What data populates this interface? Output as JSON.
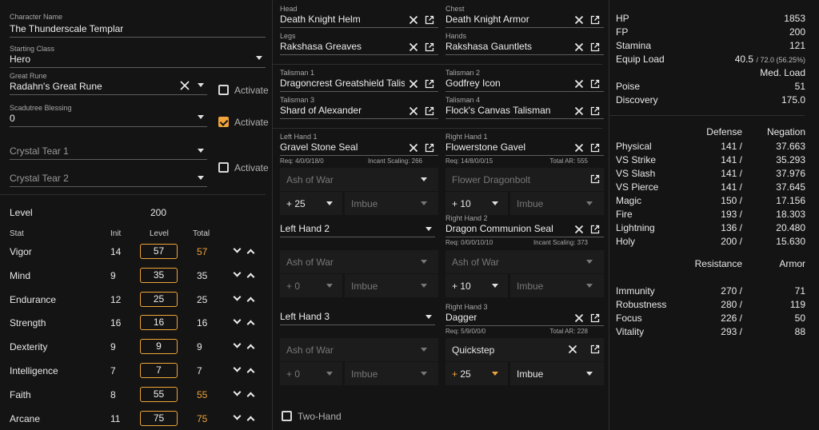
{
  "left": {
    "character_name": {
      "label": "Character Name",
      "value": "The Thunderscale Templar"
    },
    "starting_class": {
      "label": "Starting Class",
      "value": "Hero"
    },
    "great_rune": {
      "label": "Great Rune",
      "value": "Radahn's Great Rune",
      "activate_label": "Activate"
    },
    "scadutree": {
      "label": "Scadutree Blessing",
      "value": "0",
      "activate_label": "Activate"
    },
    "crystal_tear_1": "Crystal Tear 1",
    "crystal_tear_2": "Crystal Tear 2",
    "tears_activate_label": "Activate",
    "level_label": "Level",
    "level_value": "200",
    "stat_headers": {
      "stat": "Stat",
      "init": "Init",
      "level": "Level",
      "total": "Total"
    },
    "stats": [
      {
        "name": "Vigor",
        "init": "14",
        "level": "57",
        "total": "57",
        "highlight": true
      },
      {
        "name": "Mind",
        "init": "9",
        "level": "35",
        "total": "35",
        "highlight": false
      },
      {
        "name": "Endurance",
        "init": "12",
        "level": "25",
        "total": "25",
        "highlight": false
      },
      {
        "name": "Strength",
        "init": "16",
        "level": "16",
        "total": "16",
        "highlight": false
      },
      {
        "name": "Dexterity",
        "init": "9",
        "level": "9",
        "total": "9",
        "highlight": false
      },
      {
        "name": "Intelligence",
        "init": "7",
        "level": "7",
        "total": "7",
        "highlight": false
      },
      {
        "name": "Faith",
        "init": "8",
        "level": "55",
        "total": "55",
        "highlight": true
      },
      {
        "name": "Arcane",
        "init": "11",
        "level": "75",
        "total": "75",
        "highlight": true
      }
    ]
  },
  "armor": {
    "head": {
      "label": "Head",
      "value": "Death Knight Helm"
    },
    "chest": {
      "label": "Chest",
      "value": "Death Knight Armor"
    },
    "legs": {
      "label": "Legs",
      "value": "Rakshasa Greaves"
    },
    "hands": {
      "label": "Hands",
      "value": "Rakshasa Gauntlets"
    }
  },
  "talismans": {
    "t1": {
      "label": "Talisman 1",
      "value": "Dragoncrest Greatshield Talisman"
    },
    "t2": {
      "label": "Talisman 2",
      "value": "Godfrey Icon"
    },
    "t3": {
      "label": "Talisman 3",
      "value": "Shard of Alexander"
    },
    "t4": {
      "label": "Talisman 4",
      "value": "Flock's Canvas Talisman"
    }
  },
  "weapons": {
    "lh1": {
      "label": "Left Hand 1",
      "value": "Gravel Stone Seal",
      "req": "Req: 4/0/0/18/0",
      "extra": "Incant Scaling: 266",
      "aow": "Ash of War",
      "upgrade": "+ 25",
      "affinity": "Imbue"
    },
    "rh1": {
      "label": "Right Hand 1",
      "value": "Flowerstone Gavel",
      "req": "Req: 14/8/0/0/15",
      "extra": "Total AR: 555",
      "aow": "Flower Dragonbolt",
      "upgrade": "+ 10",
      "affinity": "Imbue"
    },
    "lh2": {
      "value": "Left Hand 2",
      "aow": "Ash of War",
      "upgrade": "+ 0",
      "affinity": "Imbue"
    },
    "rh2": {
      "label": "Right Hand 2",
      "value": "Dragon Communion Seal",
      "req": "Req: 0/0/0/10/10",
      "extra": "Incant Scaling: 373",
      "aow": "Ash of War",
      "upgrade": "+ 10",
      "affinity": "Imbue"
    },
    "lh3": {
      "value": "Left Hand 3",
      "aow": "Ash of War",
      "upgrade": "+ 0",
      "affinity": "Imbue"
    },
    "rh3": {
      "label": "Right Hand 3",
      "value": "Dagger",
      "req": "Req: 5/9/0/0/0",
      "extra": "Total AR: 228",
      "aow": "Quickstep",
      "upgrade_plus": "+",
      "upgrade_num": "25",
      "affinity": "Imbue"
    },
    "two_hand_label": "Two-Hand"
  },
  "stats_panel": {
    "top": [
      {
        "label": "HP",
        "value": "1853"
      },
      {
        "label": "FP",
        "value": "200"
      },
      {
        "label": "Stamina",
        "value": "121"
      }
    ],
    "equip_load": {
      "label": "Equip Load",
      "value": "40.5",
      "detail": "/ 72.0 (56.25%)",
      "status": "Med. Load"
    },
    "poise": {
      "label": "Poise",
      "value": "51"
    },
    "discovery": {
      "label": "Discovery",
      "value": "175.0"
    },
    "def_headers": {
      "defense": "Defense",
      "negation": "Negation"
    },
    "defense": [
      {
        "name": "Physical",
        "def": "141 /",
        "neg": "37.663"
      },
      {
        "name": "VS Strike",
        "def": "141 /",
        "neg": "35.293"
      },
      {
        "name": "VS Slash",
        "def": "141 /",
        "neg": "37.976"
      },
      {
        "name": "VS Pierce",
        "def": "141 /",
        "neg": "37.645"
      },
      {
        "name": "Magic",
        "def": "150 /",
        "neg": "17.156"
      },
      {
        "name": "Fire",
        "def": "193 /",
        "neg": "18.303"
      },
      {
        "name": "Lightning",
        "def": "136 /",
        "neg": "20.480"
      },
      {
        "name": "Holy",
        "def": "200 /",
        "neg": "15.630"
      }
    ],
    "res_headers": {
      "resistance": "Resistance",
      "armor": "Armor"
    },
    "resistance": [
      {
        "name": "Immunity",
        "res": "270 /",
        "armor": "71"
      },
      {
        "name": "Robustness",
        "res": "280 /",
        "armor": "119"
      },
      {
        "name": "Focus",
        "res": "226 /",
        "armor": "50"
      },
      {
        "name": "Vitality",
        "res": "293 /",
        "armor": "88"
      }
    ]
  },
  "colors": {
    "accent": "#f0a43a",
    "background": "#141414"
  }
}
